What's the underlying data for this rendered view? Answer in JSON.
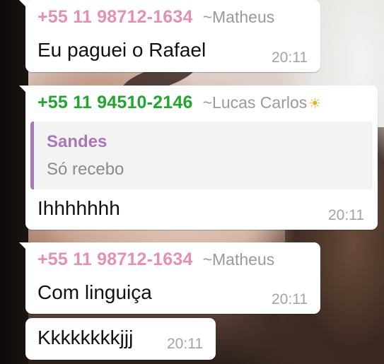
{
  "colors": {
    "matheus": "#e68fb4",
    "lucas": "#1fa72e",
    "quote_author": "#a877b9",
    "quote_bar": "#a877b9"
  },
  "messages": [
    {
      "phone": "+55 11 98712-1634",
      "pushname": "~Matheus",
      "text": "Eu paguei o Rafael",
      "time": "20:11"
    },
    {
      "phone": "+55 11 94510-2146",
      "pushname": "~Lucas Carlos",
      "pushname_icon": "sun-emoji-icon",
      "quote": {
        "author": "Sandes",
        "text": "Só recebo"
      },
      "text": "Ihhhhhhh",
      "time": "20:11"
    },
    {
      "phone": "+55 11 98712-1634",
      "pushname": "~Matheus",
      "text": "Com linguiça",
      "time": "20:11"
    },
    {
      "text": "Kkkkkkkkjjj",
      "time": "20:11"
    }
  ]
}
